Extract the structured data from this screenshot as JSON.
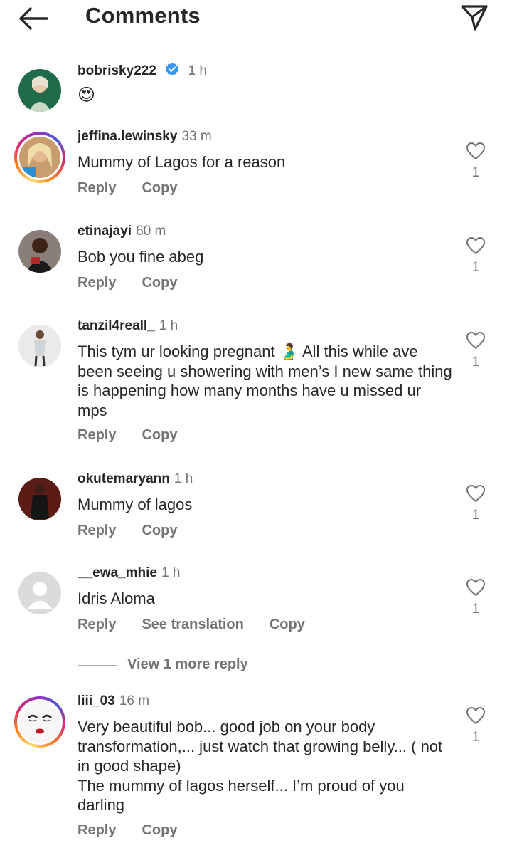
{
  "header": {
    "title": "Comments"
  },
  "caption": {
    "username": "bobrisky222",
    "time": "1 h",
    "text": "😍"
  },
  "comments": [
    {
      "username": "jeffina.lewinsky",
      "time": "33 m",
      "text": "Mummy of Lagos for a reason",
      "likes": "1",
      "actions": [
        "Reply",
        "Copy"
      ]
    },
    {
      "username": "etinajayi",
      "time": "60 m",
      "text": "Bob you fine abeg",
      "likes": "1",
      "actions": [
        "Reply",
        "Copy"
      ]
    },
    {
      "username": "tanzil4reall_",
      "time": "1 h",
      "text": "This tym ur looking pregnant 🫃 All this while ave been seeing u showering with men’s I new same thing is happening how many months have u missed ur mps",
      "likes": "1",
      "actions": [
        "Reply",
        "Copy"
      ]
    },
    {
      "username": "okutemaryann",
      "time": "1 h",
      "text": "Mummy of lagos",
      "likes": "1",
      "actions": [
        "Reply",
        "Copy"
      ]
    },
    {
      "username": "__ewa_mhie",
      "time": "1 h",
      "text": "Idris Aloma",
      "likes": "1",
      "actions": [
        "Reply",
        "See translation",
        "Copy"
      ]
    },
    {
      "username": "liii_03",
      "time": "16 m",
      "text": "Very beautiful bob... good job on your body transformation,... just watch that growing belly... ( not in good shape)\nThe mummy of lagos herself... I’m proud of you darling",
      "likes": "1",
      "actions": [
        "Reply",
        "Copy"
      ]
    }
  ],
  "view_more": {
    "label": "View 1 more reply"
  },
  "icons": {
    "back": "arrow-left-icon",
    "send": "paper-plane-icon",
    "verified": "verified-badge-icon",
    "like": "heart-outline-icon"
  },
  "colors": {
    "verified": "#3897f0",
    "muted": "#737373",
    "text": "#262626",
    "divider": "#dbdbdb"
  }
}
